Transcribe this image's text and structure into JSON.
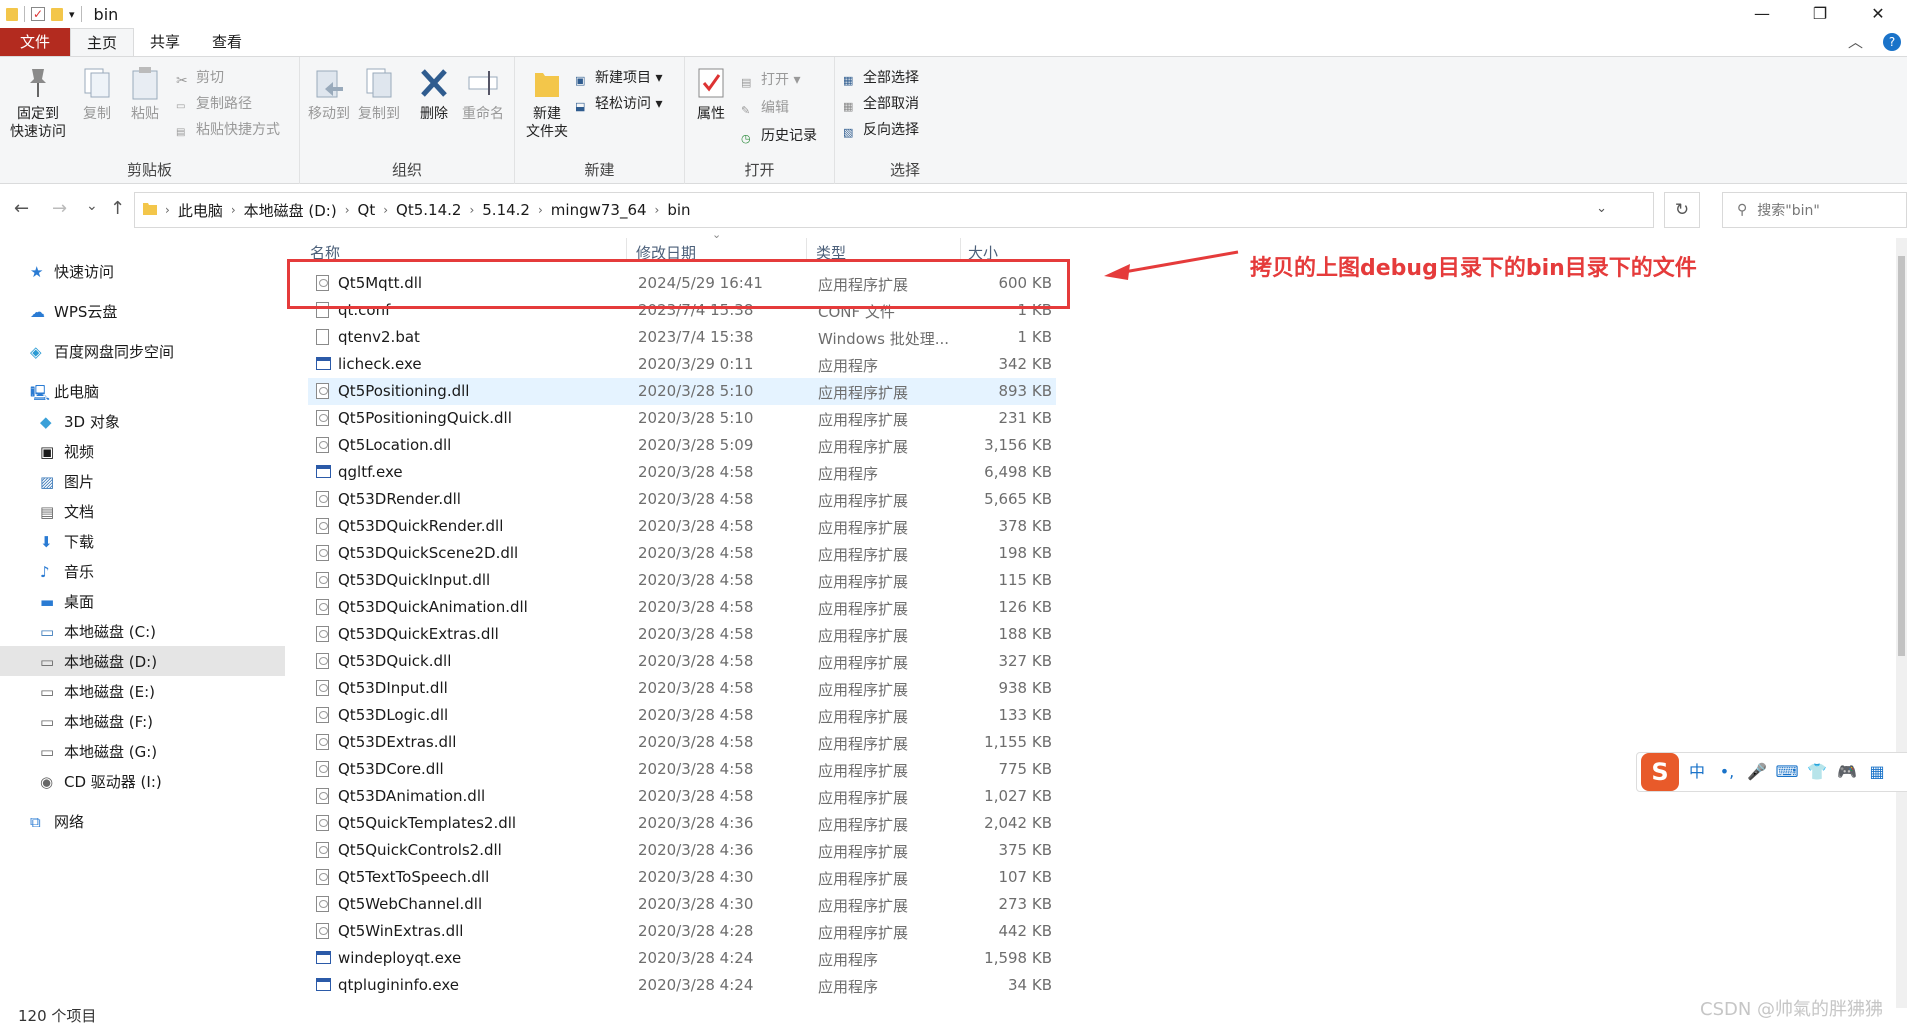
{
  "window": {
    "title": "bin",
    "minimize": "—",
    "restore": "❐",
    "close": "✕"
  },
  "tabs": {
    "file": "文件",
    "home": "主页",
    "share": "共享",
    "view": "查看",
    "collapse": "︿",
    "help": "?"
  },
  "ribbon": {
    "clipboard": {
      "label": "剪贴板",
      "pin": "固定到\n快速访问",
      "pin_l1": "固定到",
      "pin_l2": "快速访问",
      "copy": "复制",
      "paste": "粘贴",
      "cut": "剪切",
      "copy_path": "复制路径",
      "paste_shortcut": "粘贴快捷方式"
    },
    "organize": {
      "label": "组织",
      "move_to": "移动到",
      "copy_to": "复制到",
      "delete": "删除",
      "rename": "重命名"
    },
    "new": {
      "label": "新建",
      "new_folder_l1": "新建",
      "new_folder_l2": "文件夹",
      "new_item": "新建项目 ▾",
      "easy_access": "轻松访问 ▾"
    },
    "open": {
      "label": "打开",
      "properties": "属性",
      "open": "打开 ▾",
      "edit": "编辑",
      "history": "历史记录"
    },
    "select": {
      "label": "选择",
      "select_all": "全部选择",
      "select_none": "全部取消",
      "invert": "反向选择"
    }
  },
  "address": {
    "back": "←",
    "forward": "→",
    "recent": "⌄",
    "up": "↑",
    "crumbs": [
      "此电脑",
      "本地磁盘 (D:)",
      "Qt",
      "Qt5.14.2",
      "5.14.2",
      "mingw73_64",
      "bin"
    ],
    "refresh": "↻",
    "search_placeholder": "搜索\"bin\""
  },
  "nav": {
    "quick_access": "快速访问",
    "wps": "WPS云盘",
    "baidu": "百度网盘同步空间",
    "this_pc": "此电脑",
    "items": [
      "3D 对象",
      "视频",
      "图片",
      "文档",
      "下载",
      "音乐",
      "桌面",
      "本地磁盘 (C:)",
      "本地磁盘 (D:)",
      "本地磁盘 (E:)",
      "本地磁盘 (F:)",
      "本地磁盘 (G:)",
      "CD 驱动器 (I:)"
    ],
    "network": "网络"
  },
  "columns": {
    "name": "名称",
    "date": "修改日期",
    "type": "类型",
    "size": "大小"
  },
  "files": [
    {
      "name": "Qt5Mqtt.dll",
      "date": "2024/5/29 16:41",
      "type": "应用程序扩展",
      "size": "600 KB",
      "kind": "dll"
    },
    {
      "name": "qt.conf",
      "date": "2023/7/4 15:38",
      "type": "CONF 文件",
      "size": "1 KB",
      "kind": "file"
    },
    {
      "name": "qtenv2.bat",
      "date": "2023/7/4 15:38",
      "type": "Windows 批处理...",
      "size": "1 KB",
      "kind": "file"
    },
    {
      "name": "licheck.exe",
      "date": "2020/3/29 0:11",
      "type": "应用程序",
      "size": "342 KB",
      "kind": "exe"
    },
    {
      "name": "Qt5Positioning.dll",
      "date": "2020/3/28 5:10",
      "type": "应用程序扩展",
      "size": "893 KB",
      "kind": "dll"
    },
    {
      "name": "Qt5PositioningQuick.dll",
      "date": "2020/3/28 5:10",
      "type": "应用程序扩展",
      "size": "231 KB",
      "kind": "dll"
    },
    {
      "name": "Qt5Location.dll",
      "date": "2020/3/28 5:09",
      "type": "应用程序扩展",
      "size": "3,156 KB",
      "kind": "dll"
    },
    {
      "name": "qgltf.exe",
      "date": "2020/3/28 4:58",
      "type": "应用程序",
      "size": "6,498 KB",
      "kind": "exe"
    },
    {
      "name": "Qt53DRender.dll",
      "date": "2020/3/28 4:58",
      "type": "应用程序扩展",
      "size": "5,665 KB",
      "kind": "dll"
    },
    {
      "name": "Qt53DQuickRender.dll",
      "date": "2020/3/28 4:58",
      "type": "应用程序扩展",
      "size": "378 KB",
      "kind": "dll"
    },
    {
      "name": "Qt53DQuickScene2D.dll",
      "date": "2020/3/28 4:58",
      "type": "应用程序扩展",
      "size": "198 KB",
      "kind": "dll"
    },
    {
      "name": "Qt53DQuickInput.dll",
      "date": "2020/3/28 4:58",
      "type": "应用程序扩展",
      "size": "115 KB",
      "kind": "dll"
    },
    {
      "name": "Qt53DQuickAnimation.dll",
      "date": "2020/3/28 4:58",
      "type": "应用程序扩展",
      "size": "126 KB",
      "kind": "dll"
    },
    {
      "name": "Qt53DQuickExtras.dll",
      "date": "2020/3/28 4:58",
      "type": "应用程序扩展",
      "size": "188 KB",
      "kind": "dll"
    },
    {
      "name": "Qt53DQuick.dll",
      "date": "2020/3/28 4:58",
      "type": "应用程序扩展",
      "size": "327 KB",
      "kind": "dll"
    },
    {
      "name": "Qt53DInput.dll",
      "date": "2020/3/28 4:58",
      "type": "应用程序扩展",
      "size": "938 KB",
      "kind": "dll"
    },
    {
      "name": "Qt53DLogic.dll",
      "date": "2020/3/28 4:58",
      "type": "应用程序扩展",
      "size": "133 KB",
      "kind": "dll"
    },
    {
      "name": "Qt53DExtras.dll",
      "date": "2020/3/28 4:58",
      "type": "应用程序扩展",
      "size": "1,155 KB",
      "kind": "dll"
    },
    {
      "name": "Qt53DCore.dll",
      "date": "2020/3/28 4:58",
      "type": "应用程序扩展",
      "size": "775 KB",
      "kind": "dll"
    },
    {
      "name": "Qt53DAnimation.dll",
      "date": "2020/3/28 4:58",
      "type": "应用程序扩展",
      "size": "1,027 KB",
      "kind": "dll"
    },
    {
      "name": "Qt5QuickTemplates2.dll",
      "date": "2020/3/28 4:36",
      "type": "应用程序扩展",
      "size": "2,042 KB",
      "kind": "dll"
    },
    {
      "name": "Qt5QuickControls2.dll",
      "date": "2020/3/28 4:36",
      "type": "应用程序扩展",
      "size": "375 KB",
      "kind": "dll"
    },
    {
      "name": "Qt5TextToSpeech.dll",
      "date": "2020/3/28 4:30",
      "type": "应用程序扩展",
      "size": "107 KB",
      "kind": "dll"
    },
    {
      "name": "Qt5WebChannel.dll",
      "date": "2020/3/28 4:30",
      "type": "应用程序扩展",
      "size": "273 KB",
      "kind": "dll"
    },
    {
      "name": "Qt5WinExtras.dll",
      "date": "2020/3/28 4:28",
      "type": "应用程序扩展",
      "size": "442 KB",
      "kind": "dll"
    },
    {
      "name": "windeployqt.exe",
      "date": "2020/3/28 4:24",
      "type": "应用程序",
      "size": "1,598 KB",
      "kind": "exe"
    },
    {
      "name": "qtplugininfo.exe",
      "date": "2020/3/28 4:24",
      "type": "应用程序",
      "size": "34 KB",
      "kind": "exe"
    }
  ],
  "annotation": "拷贝的上图debug目录下的bin目录下的文件",
  "status": "120 个项目",
  "watermark": "CSDN @帅氣的胖狒狒",
  "ime": {
    "logo": "S",
    "lang": "中",
    "punct": "•,",
    "mic": "🎤",
    "keyboard": "⌨",
    "skin": "👕",
    "game": "🎮",
    "apps": "▦"
  },
  "colors": {
    "file_tab": "#b32b1f",
    "annotation_red": "#e53b3b",
    "selection": "#cce8ff"
  }
}
